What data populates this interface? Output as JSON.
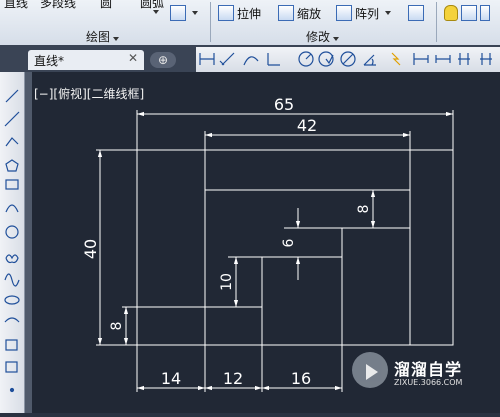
{
  "ribbon": {
    "top_partial": [
      "直线",
      "多段线",
      "圆",
      "圆弧"
    ],
    "modify": {
      "stretch": "拉伸",
      "scale": "缩放",
      "array": "阵列"
    },
    "panels": {
      "draw": "绘图",
      "modify": "修改"
    }
  },
  "tabs": [
    {
      "label": "直线*"
    }
  ],
  "view_label": "[−][俯视][二维线框]",
  "chart_data": {
    "type": "cad-drawing",
    "dimensions": [
      {
        "label": "65",
        "orientation": "horizontal"
      },
      {
        "label": "42",
        "orientation": "horizontal"
      },
      {
        "label": "40",
        "orientation": "vertical"
      },
      {
        "label": "8",
        "orientation": "vertical"
      },
      {
        "label": "6",
        "orientation": "vertical"
      },
      {
        "label": "10",
        "orientation": "vertical"
      },
      {
        "label": "8",
        "orientation": "vertical"
      },
      {
        "label": "14",
        "orientation": "horizontal"
      },
      {
        "label": "12",
        "orientation": "horizontal"
      },
      {
        "label": "16",
        "orientation": "horizontal"
      }
    ]
  },
  "watermark": {
    "title": "溜溜自学",
    "url": "ZIXUE.3066.COM"
  },
  "colors": {
    "canvas": "#212835",
    "geometry": "#ffffff"
  }
}
